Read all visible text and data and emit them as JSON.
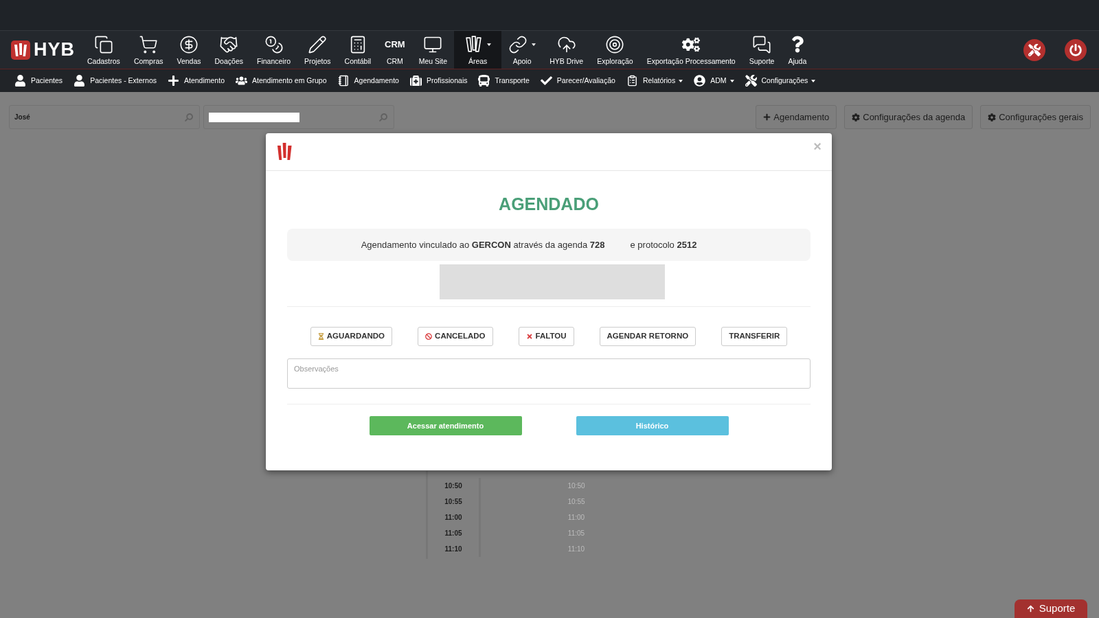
{
  "navbar": {
    "brand": "HYB",
    "items": [
      {
        "kind": "icon",
        "label": "Cadastros",
        "selected": false,
        "has_menu": false
      },
      {
        "kind": "icon",
        "label": "Compras",
        "selected": false,
        "has_menu": false
      },
      {
        "kind": "icon",
        "label": "Vendas",
        "selected": false,
        "has_menu": false
      },
      {
        "kind": "icon",
        "label": "Doações",
        "selected": false,
        "has_menu": false
      },
      {
        "kind": "icon",
        "label": "Financeiro",
        "selected": false,
        "has_menu": false
      },
      {
        "kind": "icon",
        "label": "Projetos",
        "selected": false,
        "has_menu": false
      },
      {
        "kind": "icon",
        "label": "Contábil",
        "selected": false,
        "has_menu": false
      },
      {
        "kind": "text_icon",
        "icon_text": "CRM",
        "label": "CRM",
        "selected": false,
        "has_menu": false
      },
      {
        "kind": "icon",
        "label": "Meu Site",
        "selected": false,
        "has_menu": false
      },
      {
        "kind": "icon",
        "label": "Áreas",
        "selected": true,
        "has_menu": true
      },
      {
        "kind": "icon",
        "label": "Apoio",
        "selected": false,
        "has_menu": true
      },
      {
        "kind": "icon",
        "label": "HYB Drive",
        "selected": false,
        "has_menu": false
      },
      {
        "kind": "icon",
        "label": "Exploração",
        "selected": false,
        "has_menu": false
      },
      {
        "kind": "icon",
        "label": "Exportação Processamento",
        "selected": false,
        "has_menu": false
      },
      {
        "kind": "icon",
        "label": "Suporte",
        "selected": false,
        "has_menu": false
      },
      {
        "kind": "icon",
        "label": "Ajuda",
        "selected": false,
        "has_menu": false
      }
    ]
  },
  "subnav": {
    "items": [
      {
        "label": "Pacientes",
        "has_menu": false
      },
      {
        "label": "Pacientes - Externos",
        "has_menu": false
      },
      {
        "label": "Atendimento",
        "has_menu": false
      },
      {
        "label": "Atendimento em Grupo",
        "has_menu": false
      },
      {
        "label": "Agendamento",
        "has_menu": false
      },
      {
        "label": "Profissionais",
        "has_menu": false
      },
      {
        "label": "Transporte",
        "has_menu": false
      },
      {
        "label": "Parecer/Avaliação",
        "has_menu": false
      },
      {
        "label": "Relatórios",
        "has_menu": true
      },
      {
        "label": "ADM",
        "has_menu": true
      },
      {
        "label": "Configurações",
        "has_menu": true
      }
    ]
  },
  "toolbar": {
    "search_fields": [
      {
        "value": "José",
        "redacted": false
      },
      {
        "redacted": true
      }
    ],
    "buttons": [
      {
        "kind": "add",
        "label": "Agendamento"
      },
      {
        "kind": "settings",
        "label": "Configurações da agenda"
      },
      {
        "kind": "settings",
        "label": "Configurações gerais"
      }
    ]
  },
  "schedule": {
    "rows": [
      {
        "time": "10:50",
        "slot": "10:50"
      },
      {
        "time": "10:55",
        "slot": "10:55"
      },
      {
        "time": "11:00",
        "slot": "11:00"
      },
      {
        "time": "11:05",
        "slot": "11:05"
      },
      {
        "time": "11:10",
        "slot": "11:10"
      }
    ]
  },
  "modal": {
    "close_label": "×",
    "status": "AGENDADO",
    "info_parts": [
      "Agendamento vinculado ao **GERCON** através da agenda **728**",
      "e protocolo **2512**"
    ],
    "status_buttons": [
      {
        "kind": "waiting",
        "label": "AGUARDANDO"
      },
      {
        "kind": "cancelled",
        "label": "CANCELADO"
      },
      {
        "kind": "absent",
        "label": "FALTOU"
      },
      {
        "kind": "plain",
        "label": "AGENDAR RETORNO"
      },
      {
        "kind": "plain",
        "label": "TRANSFERIR"
      }
    ],
    "notes": {
      "placeholder": "Observações"
    },
    "actions": [
      {
        "label": "Acessar atendimento",
        "color": "#5cb85c"
      },
      {
        "label": "Histórico",
        "color": "#5bc0de"
      }
    ]
  },
  "support_button": {
    "label": "Suporte"
  }
}
